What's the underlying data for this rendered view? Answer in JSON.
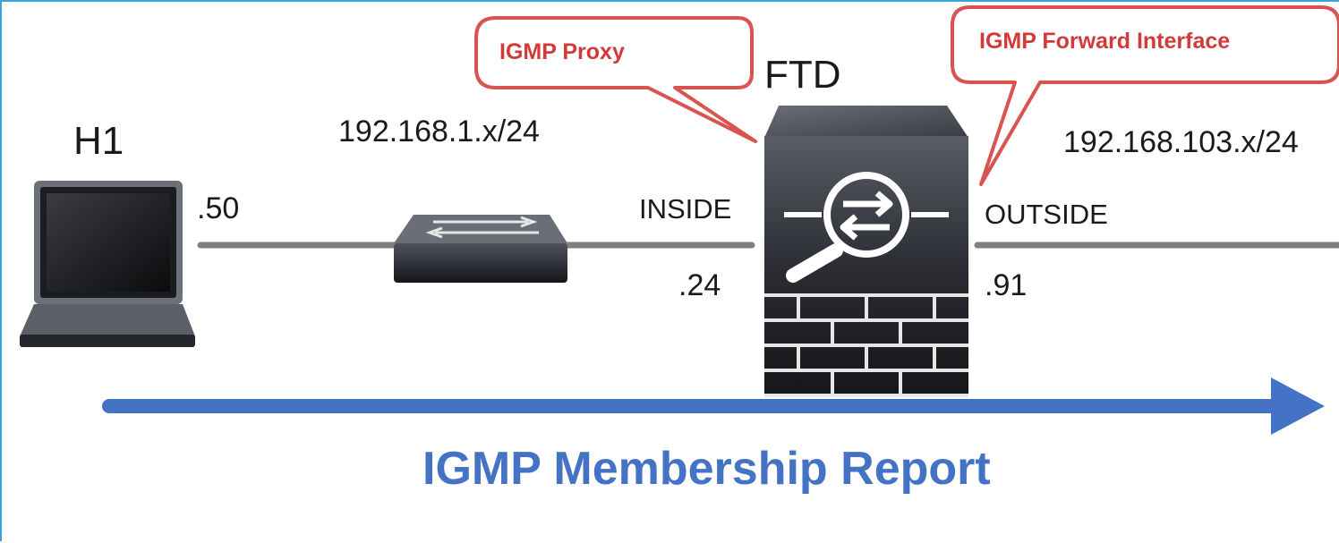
{
  "host_label": "H1",
  "device_label": "FTD",
  "callouts": {
    "proxy": "IGMP Proxy",
    "forward": "IGMP Forward Interface"
  },
  "inside_network": "192.168.1.x/24",
  "outside_network": "192.168.103.x/24",
  "host_ip_suffix": ".50",
  "inside_interface": "INSIDE",
  "inside_ip_suffix": ".24",
  "outside_interface": "OUTSIDE",
  "outside_ip_suffix": ".91",
  "flow_label": "IGMP Membership Report",
  "colors": {
    "callout_border": "#d9534f",
    "callout_text": "#d23a3a",
    "arrow": "#4472c4",
    "link": "#7f7f7f",
    "frame": "#3aa3d8"
  }
}
